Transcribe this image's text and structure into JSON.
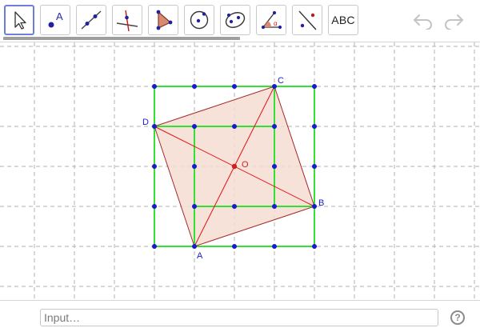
{
  "toolbar": {
    "tools": [
      {
        "name": "move-tool",
        "icon": "cursor-arrow-icon",
        "selected": true
      },
      {
        "name": "point-tool",
        "icon": "point-icon",
        "label": "A"
      },
      {
        "name": "line-tool",
        "icon": "line-through-points-icon"
      },
      {
        "name": "perpendicular-line-tool",
        "icon": "perpendicular-line-icon"
      },
      {
        "name": "polygon-tool",
        "icon": "polygon-icon"
      },
      {
        "name": "circle-tool",
        "icon": "circle-center-point-icon"
      },
      {
        "name": "conic-tool",
        "icon": "ellipse-icon"
      },
      {
        "name": "angle-tool",
        "icon": "angle-icon"
      },
      {
        "name": "reflect-tool",
        "icon": "reflect-about-line-icon"
      },
      {
        "name": "text-tool",
        "icon": "text-icon",
        "label": "ABC"
      }
    ],
    "undo_icon": "undo-icon",
    "redo_icon": "redo-icon"
  },
  "graphics": {
    "points": [
      {
        "name": "A",
        "label": "A"
      },
      {
        "name": "B",
        "label": "B"
      },
      {
        "name": "C",
        "label": "C"
      },
      {
        "name": "D",
        "label": "D"
      },
      {
        "name": "O",
        "label": "O"
      }
    ],
    "colors": {
      "grid_line": "#b0b0b0",
      "green_grid": "#33e033",
      "square_fill": "#f4ddd2",
      "square_edge": "#a52a2a",
      "diagonal": "#e01010",
      "lattice_point": "#1a1acc",
      "center_point": "#cc2222",
      "label_blue": "#1a1acc",
      "label_red": "#cc2222"
    }
  },
  "input_bar": {
    "placeholder": "Input…",
    "help_label": "?"
  }
}
